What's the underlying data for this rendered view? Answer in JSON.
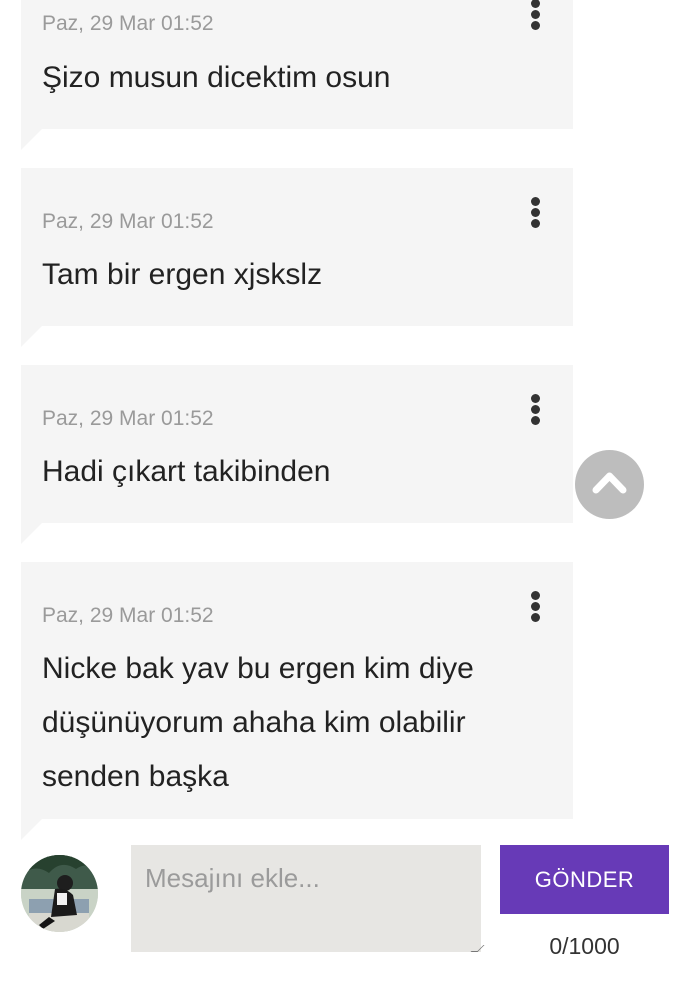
{
  "messages": [
    {
      "date": "Paz, 29 Mar 01:52",
      "text": "Şizo musun dicektim osun"
    },
    {
      "date": "Paz, 29 Mar 01:52",
      "text": "Tam bir ergen xjskslz"
    },
    {
      "date": "Paz, 29 Mar 01:52",
      "text": "Hadi çıkart takibinden"
    },
    {
      "date": "Paz, 29 Mar 01:52",
      "text": "Nicke bak yav bu ergen kim diye düşünüyorum ahaha kim olabilir senden başka"
    }
  ],
  "composer": {
    "placeholder": "Mesajını ekle...",
    "value": "",
    "send_label": "GÖNDER",
    "counter": "0/1000"
  },
  "icons": {
    "menu": "more-vert-icon",
    "scroll_top": "chevron-up-icon",
    "avatar": "user-avatar"
  },
  "colors": {
    "bubble": "#f5f5f5",
    "accent": "#673ab7",
    "input_bg": "#e7e6e3",
    "scroll_button": "#bdbdbd"
  }
}
